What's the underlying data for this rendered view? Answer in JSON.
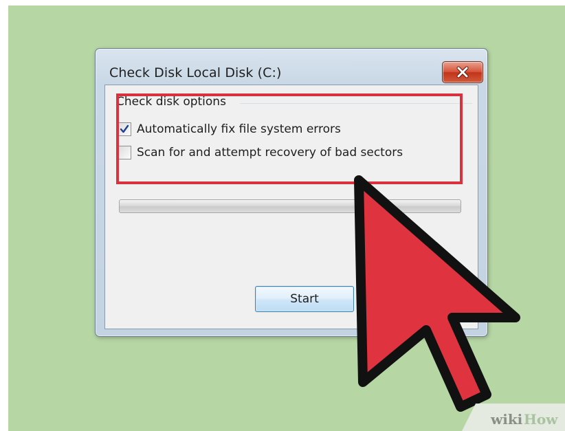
{
  "dialog": {
    "title": "Check Disk Local Disk (C:)",
    "close_icon": "close-icon"
  },
  "options": {
    "group_label": "Check disk options",
    "items": [
      {
        "label": "Automatically fix file system errors",
        "checked": true
      },
      {
        "label": "Scan for and attempt recovery of bad sectors",
        "checked": false
      }
    ]
  },
  "progress": {
    "fraction": 0
  },
  "buttons": {
    "start_label": "Start"
  },
  "overlay": {
    "pointer_icon": "mouse-pointer-icon",
    "highlight_color": "#d9323f",
    "pointer_color": "#e03340"
  },
  "watermark": {
    "logo": "wikiHow"
  },
  "colors": {
    "background": "#b6d6a4",
    "close_button": "#c9452b",
    "start_button_border": "#3c7fb1"
  }
}
